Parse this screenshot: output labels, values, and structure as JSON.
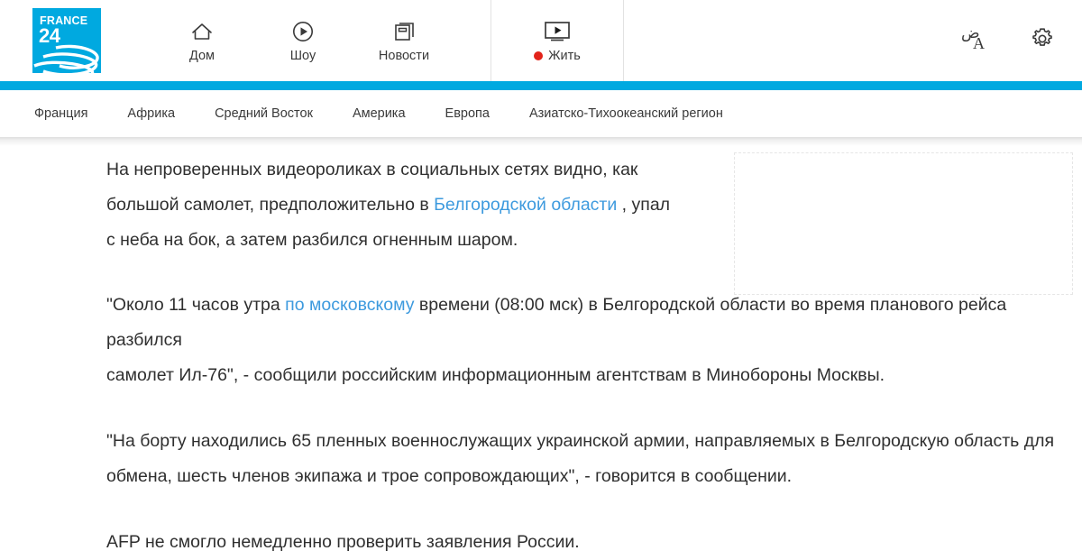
{
  "header": {
    "logo": {
      "line1": "FRANCE",
      "line2": "24",
      "alt": "france24-logo"
    },
    "nav_items": [
      {
        "label": "Дом",
        "icon": "home-icon"
      },
      {
        "label": "Шоу",
        "icon": "play-circle-icon"
      },
      {
        "label": "Новости",
        "icon": "news-pages-icon"
      }
    ],
    "live": {
      "label": "Жить",
      "icon": "tv-play-icon",
      "dot_color": "#e2231a"
    },
    "right_icons": [
      {
        "name": "language-icon",
        "arabic": "ض",
        "latin": "A"
      },
      {
        "name": "gear-icon"
      }
    ],
    "accent_color": "#00a9e0"
  },
  "sub_nav": {
    "items": [
      "Франция",
      "Африка",
      "Средний Восток",
      "Америка",
      "Европа",
      "Азиатско-Тихоокеанский регион"
    ]
  },
  "article": {
    "paragraphs": {
      "p1": {
        "highlight": "На непроверенных видеороликах в социальных сетях видно,",
        "rest_a": "как большой самолет, предположительно в ",
        "link1": "Белгородской области",
        "rest_b": " , упал с неба на бок, а затем разбился огненным шаром."
      },
      "p2": {
        "a": "\"Около 11 часов утра ",
        "link": "по московскому",
        "b": " времени (08:00 мск) в Белгородской области во время планового рейса разбился",
        "c": "самолет Ил-76\", - сообщили российским информационным агентствам в Минобороны Москвы."
      },
      "p3": {
        "text": "\"На борту находились 65 пленных военнослужащих украинской армии, направляемых в Белгородскую область для обмена, шесть членов экипажа и трое сопровождающих\", - говорится в сообщении."
      },
      "p4": {
        "highlight": "AFP не смогло немедленно проверить заявления России."
      }
    },
    "link_color": "#3d9ade",
    "highlight_color": "#e4002b"
  }
}
